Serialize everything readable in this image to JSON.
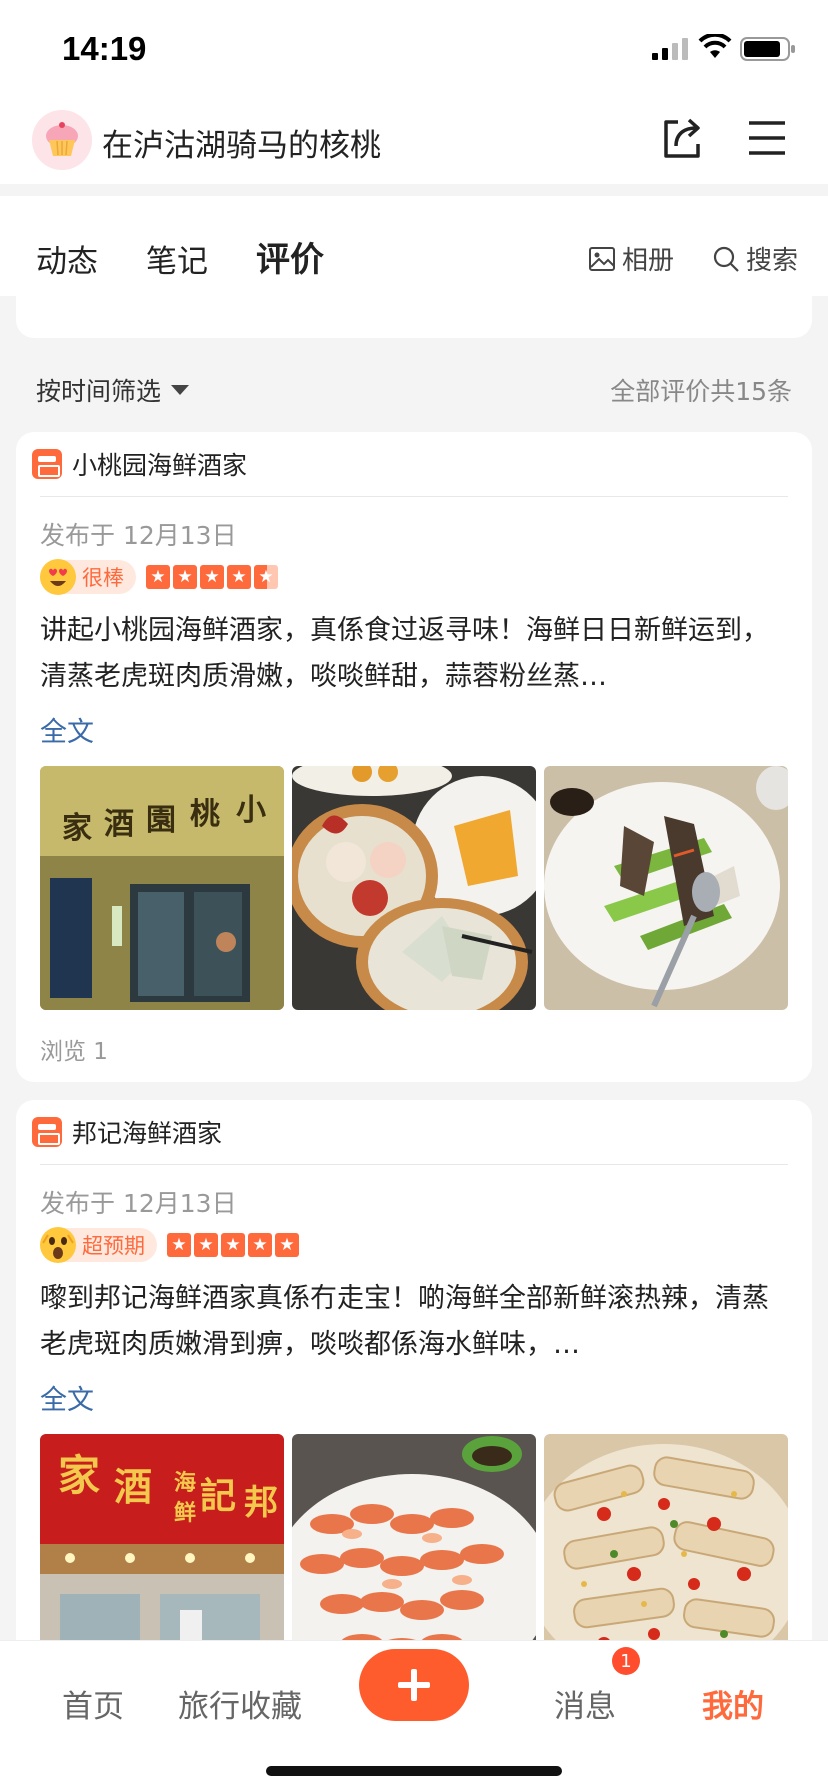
{
  "status_bar": {
    "time": "14:19"
  },
  "profile": {
    "username": "在泸沽湖骑马的核桃"
  },
  "tabs": [
    {
      "label": "动态"
    },
    {
      "label": "笔记"
    },
    {
      "label": "评价"
    }
  ],
  "tab_actions": {
    "album": "相册",
    "search": "搜索"
  },
  "filter": {
    "label": "按时间筛选",
    "summary": "全部评价共15条"
  },
  "reviews": [
    {
      "shop": "小桃园海鲜酒家",
      "date": "发布于 12月13日",
      "badge": "很棒",
      "stars": 4.5,
      "text": "讲起小桃园海鲜酒家，真係食过返寻味！海鲜日日新鲜运到，清蒸老虎斑肉质滑嫩，啖啖鲜甜，蒜蓉粉丝蒸…",
      "more": "全文",
      "photos": [
        "restaurant-storefront",
        "dim-sum-platter",
        "stir-fried-vegetables"
      ],
      "views": "浏览 1"
    },
    {
      "shop": "邦记海鲜酒家",
      "date": "发布于 12月13日",
      "badge": "超预期",
      "stars": 5,
      "text": "嚟到邦记海鲜酒家真係冇走宝！啲海鲜全部新鲜滚热辣，清蒸老虎斑肉质嫩滑到痹，啖啖都係海水鲜味，…",
      "more": "全文",
      "photos": [
        "restaurant-sign",
        "boiled-shrimp",
        "mantis-shrimp-with-chili"
      ]
    }
  ],
  "bottom_nav": {
    "home": "首页",
    "favorites": "旅行收藏",
    "messages": "消息",
    "messages_badge": "1",
    "mine": "我的"
  }
}
